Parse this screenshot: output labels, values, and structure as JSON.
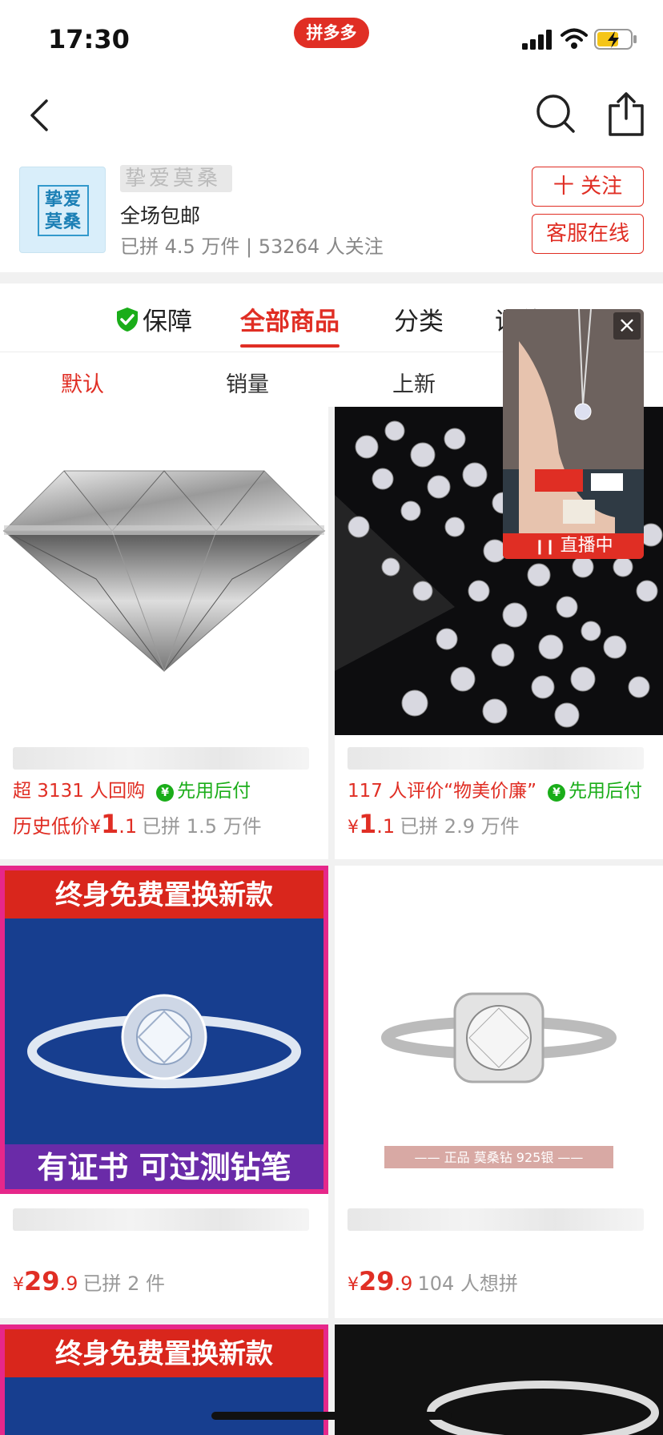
{
  "status_bar": {
    "time": "17:30",
    "app_badge": "拼多多"
  },
  "store": {
    "logo_text_line1": "挚爱",
    "logo_text_line2": "莫桑",
    "name": "挚爱莫桑",
    "tag": "全场包邮",
    "stats": "已拼 4.5 万件 | 53264 人关注",
    "follow_label": "十 关注",
    "service_label": "客服在线"
  },
  "tabs": [
    {
      "label": "保障"
    },
    {
      "label": "全部商品",
      "active": true
    },
    {
      "label": "分类"
    },
    {
      "label": "评价"
    }
  ],
  "sort": [
    "默认",
    "销量",
    "上新"
  ],
  "live": {
    "label": "直播中",
    "close": "×"
  },
  "products": [
    {
      "line2": "超 3131 人回购",
      "after_pay": "先用后付",
      "price_prefix": "历史低价",
      "yen": "¥",
      "price_int": "1",
      "price_dec": ".1",
      "sold": "已拼 1.5 万件"
    },
    {
      "line2": "117 人评价“物美价廉”",
      "after_pay": "先用后付",
      "yen": "¥",
      "price_int": "1",
      "price_dec": ".1",
      "sold": "已拼 2.9 万件"
    },
    {
      "banner_top": "终身免费置换新款",
      "banner_bottom": "有证书  可过测钻笔",
      "yen": "¥",
      "price_int": "29",
      "price_dec": ".9",
      "sold": "已拼 2 件"
    },
    {
      "ribbon": "—— 正品 莫桑钻 925银 ——",
      "yen": "¥",
      "price_int": "29",
      "price_dec": ".9",
      "sold": "104 人想拼"
    },
    {
      "banner_top": "终身免费置换新款"
    },
    {}
  ]
}
